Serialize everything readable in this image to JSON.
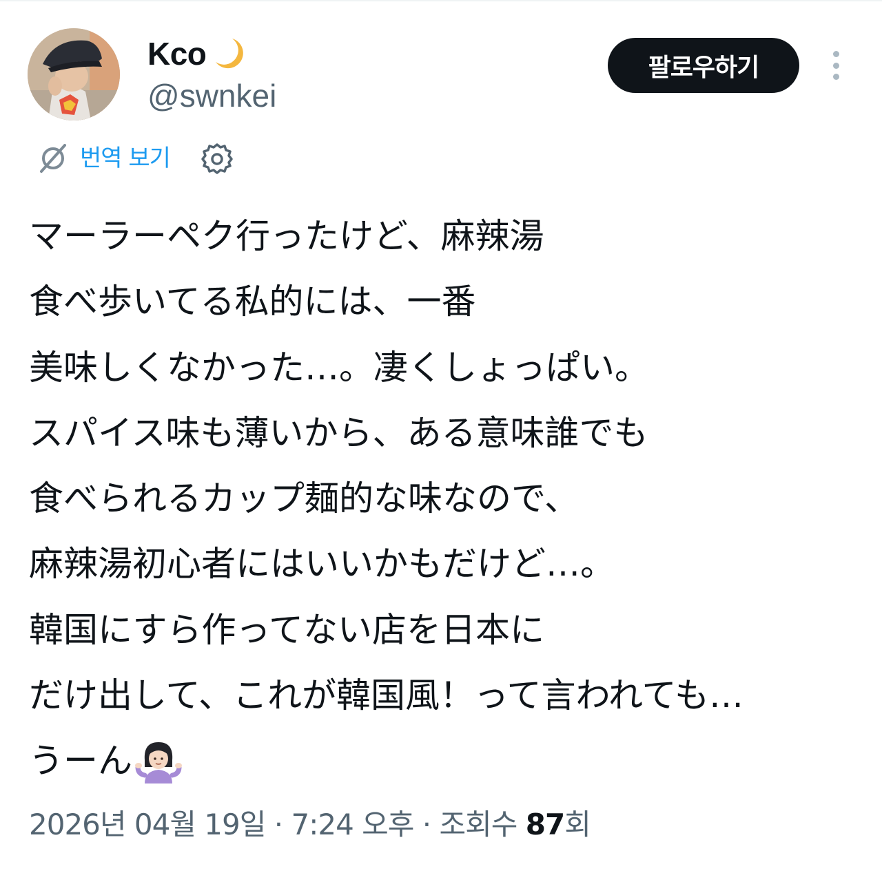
{
  "author": {
    "display_name": "Kco",
    "handle": "@swnkei",
    "avatar_icon": "profile-photo-avatar",
    "name_emoji_icon": "crescent-moon-icon"
  },
  "actions": {
    "follow_label": "팔로우하기",
    "more_icon": "vertical-dots-icon"
  },
  "translate": {
    "label": "번역 보기",
    "icon": "translate-icon",
    "settings_icon": "gear-icon"
  },
  "tweet": {
    "lines": [
      "マーラーペク行ったけど、麻辣湯",
      "食べ歩いてる私的には、一番",
      "美味しくなかった…。凄くしょっぱい。",
      "スパイス味も薄いから、ある意味誰でも",
      "食べられるカップ麺的な味なので、",
      "麻辣湯初心者にはいいかもだけど…。",
      "韓国にすら作ってない店を日本に",
      "だけ出して、これが韓国風！って言われても…",
      "うーん"
    ],
    "end_emoji_icon": "person-shrugging-emoji"
  },
  "meta": {
    "date": "2026년 04월 19일",
    "separator": "·",
    "time": "7:24 오후",
    "views_label": "조회수",
    "views_count": "87",
    "views_suffix": "회"
  },
  "colors": {
    "text": "#0f1419",
    "secondary": "#536471",
    "link": "#1d9bf0",
    "follow_bg": "#0f1419",
    "follow_text": "#ffffff",
    "moon": "#f4b73f"
  }
}
